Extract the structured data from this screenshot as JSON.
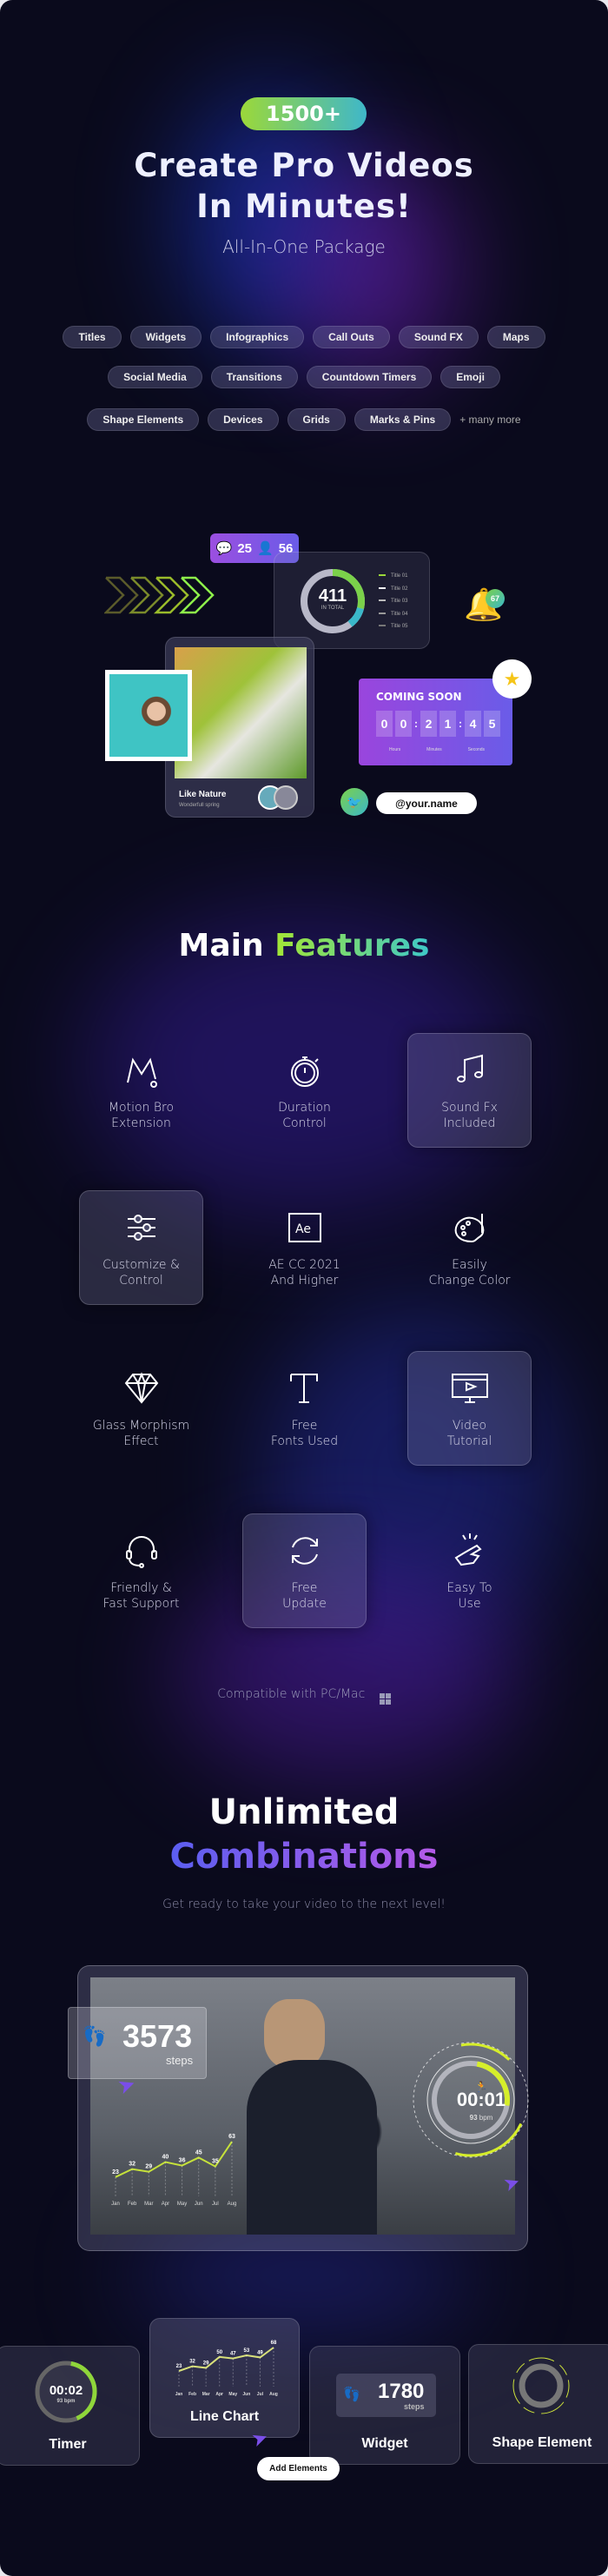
{
  "hero": {
    "badge": "1500+",
    "title_line1": "Create Pro Videos",
    "title_line2": "In Minutes!",
    "subtitle": "All-In-One Package"
  },
  "tags": {
    "rows": [
      [
        "Titles",
        "Widgets",
        "Infographics",
        "Call Outs",
        "Sound FX",
        "Maps"
      ],
      [
        "Social Media",
        "Transitions",
        "Countdown Timers",
        "Emoji"
      ],
      [
        "Shape Elements",
        "Devices",
        "Grids",
        "Marks & Pins"
      ]
    ],
    "more": "+ many more"
  },
  "showcase": {
    "comments": "25",
    "followers": "56",
    "donut": {
      "total": "411",
      "total_label": "IN TOTAL",
      "legend": [
        "Title 01",
        "Title 02",
        "Title 03",
        "Title 04",
        "Title 05"
      ]
    },
    "notification_count": "67",
    "post": {
      "title": "Like Nature",
      "subtitle": "Wonderfull spring"
    },
    "countdown": {
      "title": "COMING SOON",
      "digits": [
        "0",
        "0",
        "2",
        "1",
        "4",
        "5"
      ],
      "units": [
        "Hours",
        "Minutes",
        "Seconds"
      ]
    },
    "handle": "@your.name"
  },
  "features": {
    "title_white": "Main",
    "title_accent": "Features",
    "items": [
      {
        "icon": "motion-bro-icon",
        "label": "Motion Bro\nExtension",
        "boxed": false
      },
      {
        "icon": "stopwatch-icon",
        "label": "Duration\nControl",
        "boxed": false
      },
      {
        "icon": "music-note-icon",
        "label": "Sound Fx\nIncluded",
        "boxed": true
      },
      {
        "icon": "sliders-icon",
        "label": "Customize &\nControl",
        "boxed": true
      },
      {
        "icon": "after-effects-icon",
        "label": "AE CC 2021\nAnd Higher",
        "boxed": false
      },
      {
        "icon": "palette-icon",
        "label": "Easily\nChange Color",
        "boxed": false
      },
      {
        "icon": "diamond-icon",
        "label": "Glass Morphism\nEffect",
        "boxed": false
      },
      {
        "icon": "font-icon",
        "label": "Free\nFonts Used",
        "boxed": false
      },
      {
        "icon": "video-tutorial-icon",
        "label": "Video\nTutorial",
        "boxed": true
      },
      {
        "icon": "headset-icon",
        "label": "Friendly &\nFast Support",
        "boxed": false
      },
      {
        "icon": "refresh-icon",
        "label": "Free\nUpdate",
        "boxed": true
      },
      {
        "icon": "snap-fingers-icon",
        "label": "Easy To\nUse",
        "boxed": false
      }
    ],
    "compatible": "Compatible with PC/Mac"
  },
  "combos": {
    "title1": "Unlimited",
    "title2": "Combinations",
    "subtitle": "Get ready to take your video to the next level!"
  },
  "video": {
    "steps": "3573",
    "steps_label": "steps",
    "timer": "00:01",
    "bpm": "93",
    "bpm_unit": "bpm",
    "chart": {
      "months": [
        "Jan",
        "Feb",
        "Mar",
        "Apr",
        "May",
        "Jun",
        "Jul",
        "Aug"
      ],
      "values": [
        23,
        32,
        29,
        40,
        36,
        45,
        35,
        63
      ]
    }
  },
  "elements": {
    "timer": {
      "label": "Timer",
      "time": "00:02",
      "bpm": "93",
      "bpm_unit": "bpm"
    },
    "line_chart": {
      "label": "Line Chart",
      "months": [
        "Jan",
        "Feb",
        "Mar",
        "Apr",
        "May",
        "Jun",
        "Jul",
        "Aug"
      ],
      "values": [
        23,
        32,
        29,
        50,
        47,
        53,
        49,
        68
      ]
    },
    "widget": {
      "label": "Widget",
      "steps": "1780",
      "steps_label": "steps"
    },
    "shape": {
      "label": "Shape Element"
    },
    "add_button": "Add Elements"
  },
  "colors": {
    "accent_green": "#a3e635",
    "accent_purple": "#8b5cf6",
    "background": "#0a0a1c"
  }
}
